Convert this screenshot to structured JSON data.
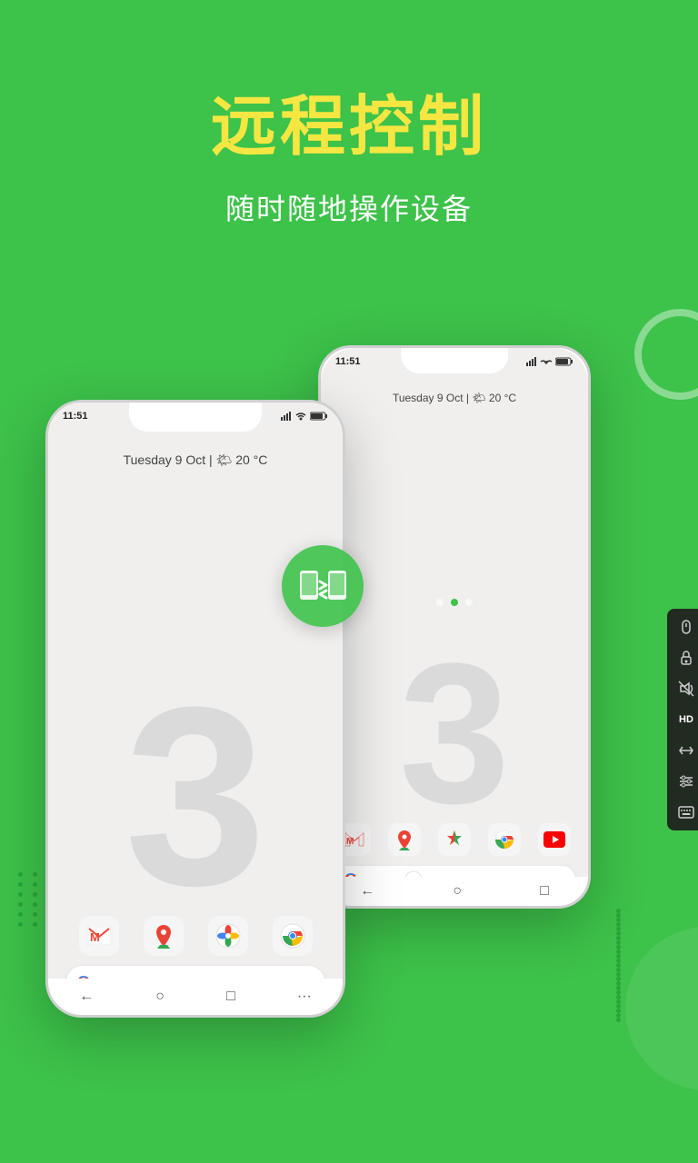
{
  "page": {
    "background_color": "#3dc24a",
    "title": "远程控制",
    "subtitle": "随时随地操作设备"
  },
  "phone_front": {
    "status_time": "11:51",
    "date_text": "Tuesday 9 Oct | 🌤 20 °C",
    "number_watermark": "3",
    "app_icons": [
      "Gmail",
      "Maps",
      "Photos",
      "Chrome"
    ],
    "google_bar_text": "G"
  },
  "phone_back": {
    "status_time": "11:51",
    "date_text": "Tuesday 9 Oct | 🌤 20 °C",
    "number_watermark": "3",
    "app_icons": [
      "Gmail",
      "Maps",
      "Photos",
      "Chrome",
      "YouTube"
    ]
  },
  "toolbar": {
    "buttons": [
      "🖱",
      "🔒",
      "🔔",
      "HD",
      "↕",
      "⚙",
      "⌨"
    ]
  },
  "sync_icon": "⇄",
  "nav": {
    "back": "←",
    "home": "○",
    "recent": "□",
    "more": "···"
  }
}
